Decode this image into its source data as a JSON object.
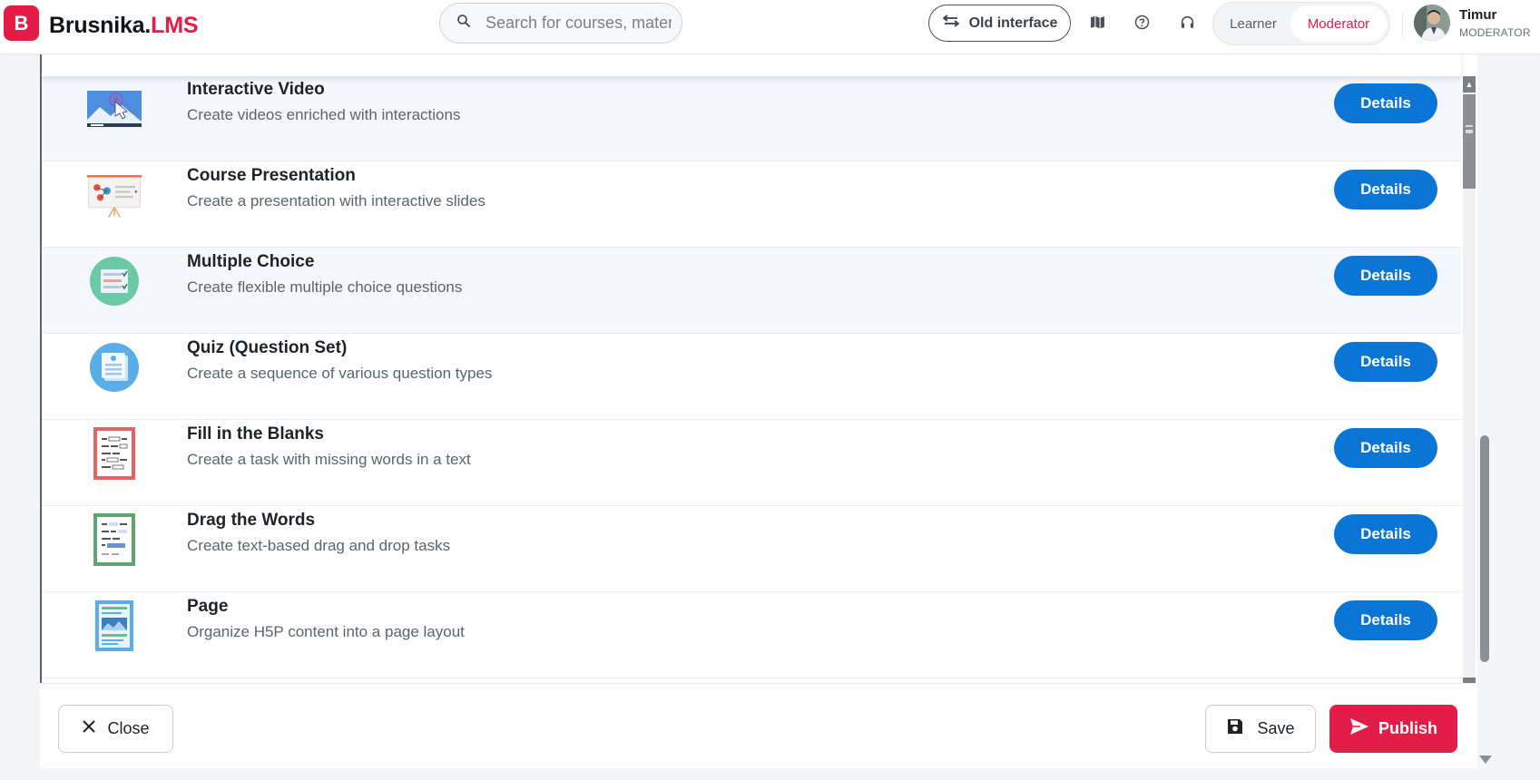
{
  "brand": {
    "logo_letter": "B",
    "name_main": "Brusnika.",
    "name_accent": "LMS",
    "accent_color": "#e11d48"
  },
  "header": {
    "search_placeholder": "Search for courses, materi",
    "old_interface_label": "Old interface",
    "roles": [
      {
        "label": "Learner",
        "active": false
      },
      {
        "label": "Moderator",
        "active": true
      }
    ],
    "user": {
      "name": "Timur",
      "role": "MODERATOR"
    },
    "icons": [
      "map-icon",
      "help-icon",
      "headset-icon"
    ]
  },
  "content_types": [
    {
      "title": "Interactive Video",
      "description": "Create videos enriched with interactions",
      "button": "Details",
      "icon": "interactive-video-icon"
    },
    {
      "title": "Course Presentation",
      "description": "Create a presentation with interactive slides",
      "button": "Details",
      "icon": "course-presentation-icon"
    },
    {
      "title": "Multiple Choice",
      "description": "Create flexible multiple choice questions",
      "button": "Details",
      "icon": "multiple-choice-icon"
    },
    {
      "title": "Quiz (Question Set)",
      "description": "Create a sequence of various question types",
      "button": "Details",
      "icon": "question-set-icon"
    },
    {
      "title": "Fill in the Blanks",
      "description": "Create a task with missing words in a text",
      "button": "Details",
      "icon": "fill-blanks-icon"
    },
    {
      "title": "Drag the Words",
      "description": "Create text-based drag and drop tasks",
      "button": "Details",
      "icon": "drag-words-icon"
    },
    {
      "title": "Page",
      "description": "Organize H5P content into a page layout",
      "button": "Details",
      "icon": "page-layout-icon"
    }
  ],
  "footer": {
    "close_label": "Close",
    "save_label": "Save",
    "publish_label": "Publish"
  },
  "colors": {
    "primary_blue": "#0b75d6",
    "publish_red": "#e11d48",
    "row_highlight": "#f4f8fc"
  }
}
